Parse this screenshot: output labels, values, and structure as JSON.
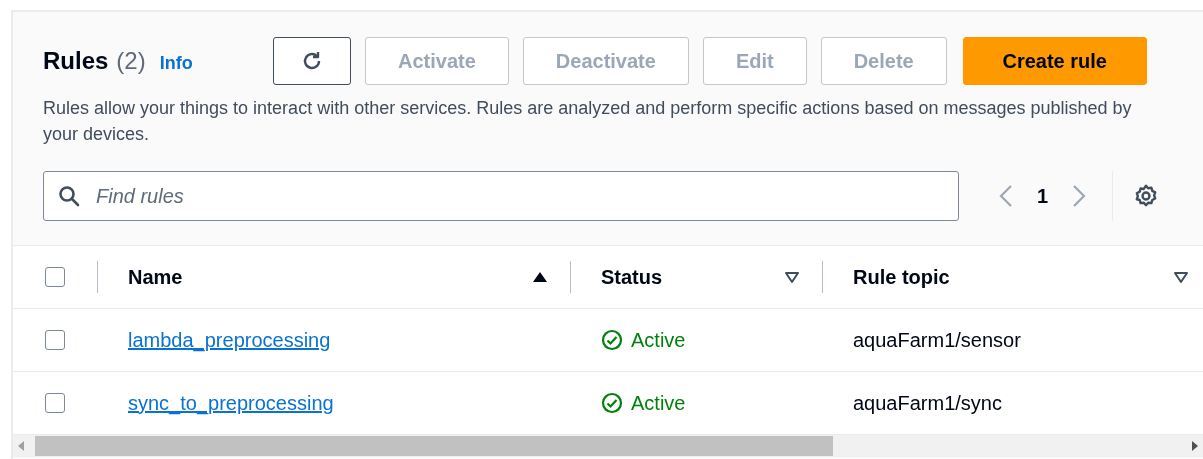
{
  "header": {
    "title": "Rules",
    "count": "(2)",
    "info": "Info"
  },
  "actions": [
    {
      "kind": "refresh",
      "disabled": false
    },
    {
      "kind": "normal",
      "label": "Activate",
      "disabled": true
    },
    {
      "kind": "normal",
      "label": "Deactivate",
      "disabled": true
    },
    {
      "kind": "normal",
      "label": "Edit",
      "disabled": true
    },
    {
      "kind": "normal",
      "label": "Delete",
      "disabled": true
    },
    {
      "kind": "primary",
      "label": "Create rule",
      "disabled": false
    }
  ],
  "description": "Rules allow your things to interact with other services. Rules are analyzed and perform specific actions based on messages published by your devices.",
  "search": {
    "placeholder": "Find rules"
  },
  "pagination": {
    "page": "1",
    "prev_disabled": true,
    "next_disabled": true
  },
  "table": {
    "select_all": {
      "checked": false
    },
    "columns": [
      {
        "label": "Name",
        "sorted": true
      },
      {
        "label": "Status",
        "sorted": false
      },
      {
        "label": "Rule topic",
        "sorted": false
      }
    ],
    "rows": [
      {
        "checked": false,
        "name": "lambda_preprocessing",
        "status": "Active",
        "topic": "aquaFarm1/sensor"
      },
      {
        "checked": false,
        "name": "sync_to_preprocessing",
        "status": "Active",
        "topic": "aquaFarm1/sync"
      }
    ]
  }
}
